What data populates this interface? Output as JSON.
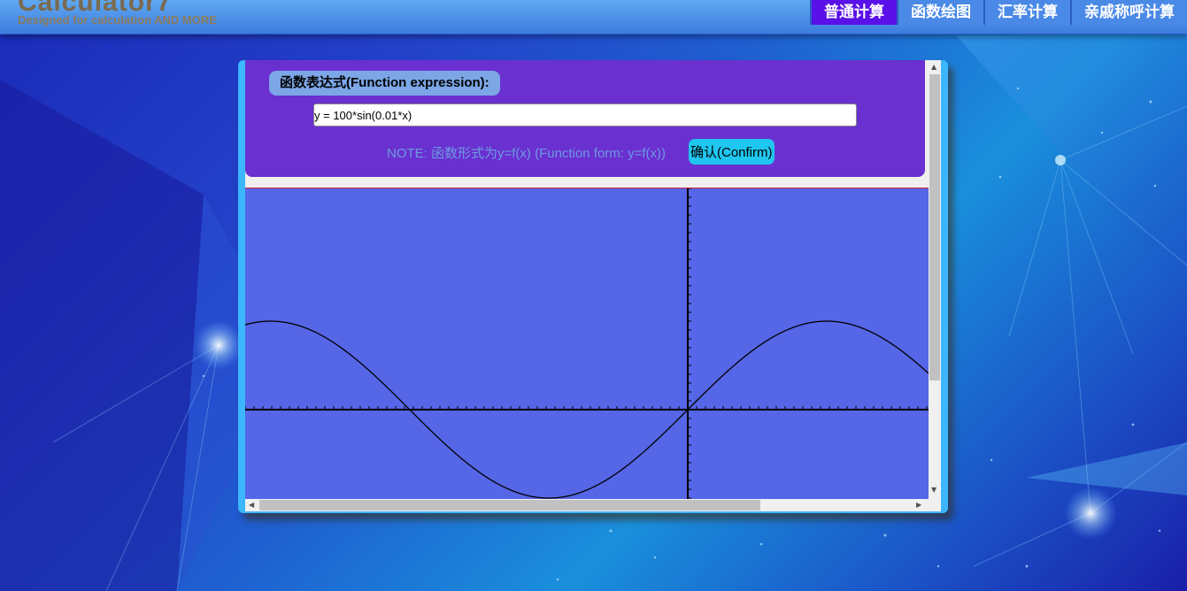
{
  "header": {
    "title": "Calculator7",
    "subtitle": "Designed for calculation AND MORE",
    "nav": [
      {
        "label": "普通计算",
        "active": true
      },
      {
        "label": "函数绘图",
        "active": false
      },
      {
        "label": "汇率计算",
        "active": false
      },
      {
        "label": "亲戚称呼计算",
        "active": false
      }
    ]
  },
  "form": {
    "expression_label": "函数表达式(Function expression):",
    "expression_value": "y = 100*sin(0.01*x)",
    "note": "NOTE: 函数形式为y=f(x) (Function form: y=f(x))",
    "confirm_label": "确认(Confirm)"
  },
  "plot": {
    "function": "100*sin(0.01*x)",
    "amplitude": 100,
    "frequency": 0.01,
    "colors": {
      "background": "#5566e6",
      "axis": "#000000",
      "curve": "#000000",
      "border": "#d02040"
    }
  },
  "colors": {
    "accent": "#5a10e8",
    "panel_border": "#3bb6ff",
    "form_bg": "#6a30d0",
    "confirm_bg": "#1ec6f0"
  },
  "icons": [
    "scroll-up-arrow-icon",
    "scroll-down-arrow-icon",
    "scroll-left-arrow-icon",
    "scroll-right-arrow-icon"
  ]
}
